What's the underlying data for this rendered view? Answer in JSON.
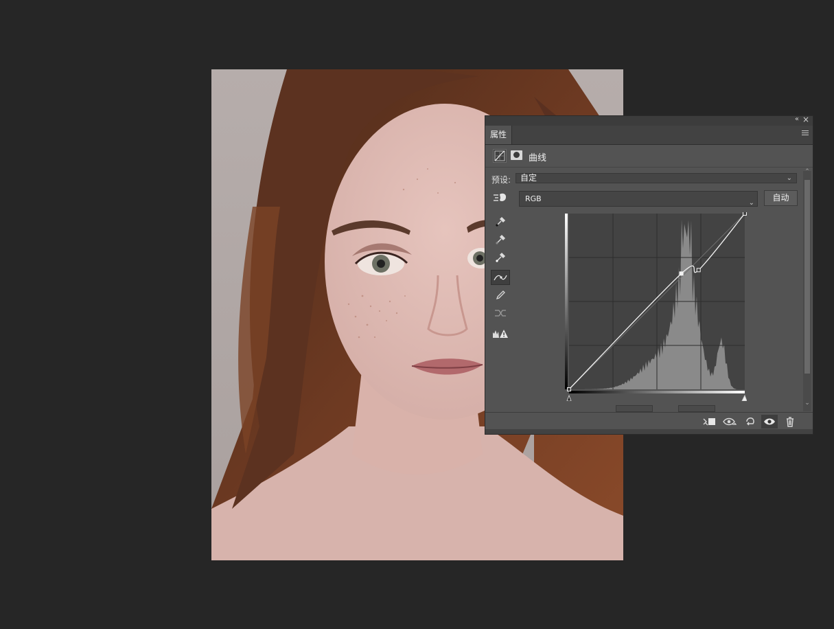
{
  "panel": {
    "tab_title": "属性",
    "adjustment_title": "曲线",
    "preset_label": "预设:",
    "preset_value": "自定",
    "channel_value": "RGB",
    "auto_label": "自动"
  },
  "icons": {
    "collapse": "double-chevron-left-icon",
    "close": "close-icon",
    "menu": "panel-menu-icon",
    "adjustment": "curves-adjustment-icon",
    "mask": "layer-mask-icon",
    "target": "on-image-adjust-icon",
    "tools": [
      "black-point-eyedropper-icon",
      "gray-point-eyedropper-icon",
      "white-point-eyedropper-icon",
      "curve-points-icon",
      "pencil-icon",
      "smooth-icon",
      "clipping-warning-icon"
    ],
    "footer": [
      "clip-to-layer-icon",
      "view-previous-state-icon",
      "reset-icon",
      "visibility-icon",
      "trash-icon"
    ]
  },
  "curve": {
    "input_range": [
      0,
      255
    ],
    "output_range": [
      0,
      255
    ],
    "control_points": [
      [
        0,
        0
      ],
      [
        163,
        168
      ],
      [
        188,
        173
      ],
      [
        255,
        255
      ]
    ]
  },
  "colors": {
    "app_background": "#262626",
    "panel_background": "#535353",
    "graph_background": "#434343",
    "histogram": "#8a8a8a",
    "curve": "#f2f2f2"
  }
}
